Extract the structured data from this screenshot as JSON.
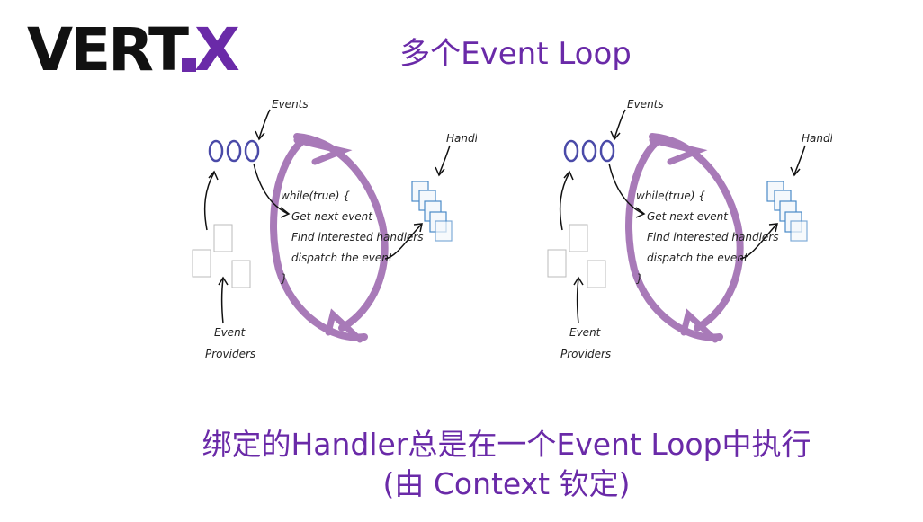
{
  "logo": {
    "text_main": "VERT",
    "text_dot": ".",
    "text_x": "X"
  },
  "title": "多个Event Loop",
  "diagram": {
    "events_label": "Events",
    "handlers_label": "Handlers",
    "providers_label_line1": "Event",
    "providers_label_line2": "Providers",
    "code_lines": [
      "while(true) {",
      "Get next event",
      "Find interested handlers",
      "dispatch the event",
      "}"
    ]
  },
  "caption": {
    "line1": "绑定的Handler总是在一个Event Loop中执行",
    "line2": "(由 Context 钦定)"
  },
  "colors": {
    "brand_black": "#111111",
    "brand_purple": "#6a2aa8",
    "loop_purple": "#a87ab8",
    "event_blue": "#4a4aa8",
    "handler_blue": "#4a8ac8"
  }
}
